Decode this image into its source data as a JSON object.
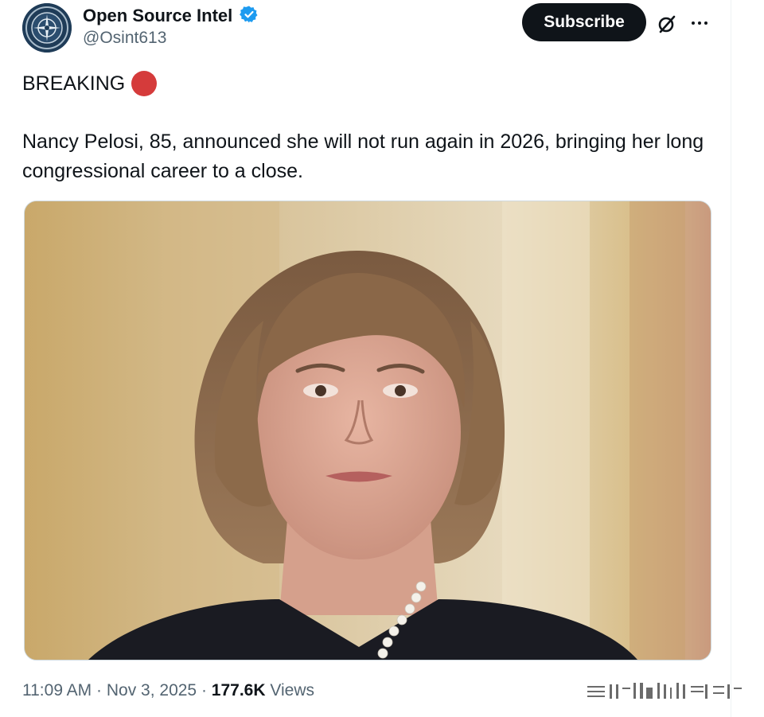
{
  "tweet": {
    "author": {
      "display_name": "Open Source Intel",
      "handle": "@Osint613",
      "verified_icon": "verified-badge-icon",
      "avatar_icon": "compass-seal-avatar"
    },
    "subscribe_label": "Subscribe",
    "header_icons": [
      "grok-icon",
      "more-icon"
    ],
    "text": {
      "headline": "BREAKING",
      "headline_icon": "red-circle-icon",
      "body": "Nancy Pelosi, 85, announced she will not run again in 2026, bringing her long congressional career to a close."
    },
    "media": {
      "type": "photo",
      "subject": "portrait photo"
    },
    "meta": {
      "time": "11:09 AM",
      "separator": "·",
      "date": "Nov 3, 2025",
      "views_count": "177.6K",
      "views_label": "Views"
    }
  },
  "colors": {
    "text_primary": "#0f1419",
    "text_secondary": "#536471",
    "verified_blue": "#1d9bf0",
    "subscribe_bg": "#0f1419",
    "red_circle": "#d53b3b",
    "border": "#cfd9de"
  }
}
